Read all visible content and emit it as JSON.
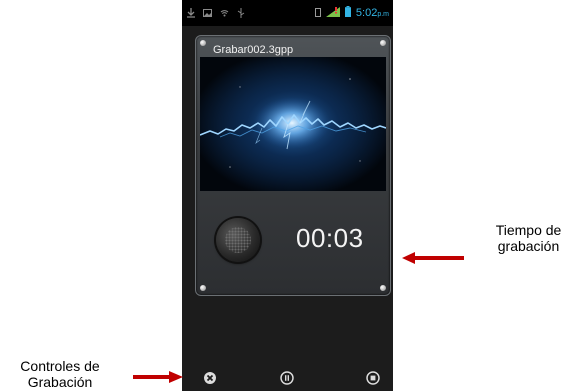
{
  "status_bar": {
    "time": "5:02",
    "ampm": "p.m",
    "icons": [
      "download-icon",
      "image-icon",
      "wifi-icon",
      "usb-icon",
      "sim-icon",
      "signal-icon",
      "battery-icon"
    ]
  },
  "recorder": {
    "file_name": "Grabar002.3gpp",
    "elapsed_time": "00:03",
    "controls": [
      {
        "name": "cancel",
        "icon": "close-icon"
      },
      {
        "name": "pause",
        "icon": "pause-icon"
      },
      {
        "name": "stop",
        "icon": "stop-icon"
      }
    ]
  },
  "annotations": {
    "recording_time_line1": "Tiempo de",
    "recording_time_line2": "grabación",
    "controls_line1": "Controles de",
    "controls_line2": "Grabación"
  },
  "colors": {
    "arrow": "#c00000",
    "clock": "#33b5e5",
    "waveform": "#9fd6ff",
    "phone_background": "#1c1c1c"
  }
}
